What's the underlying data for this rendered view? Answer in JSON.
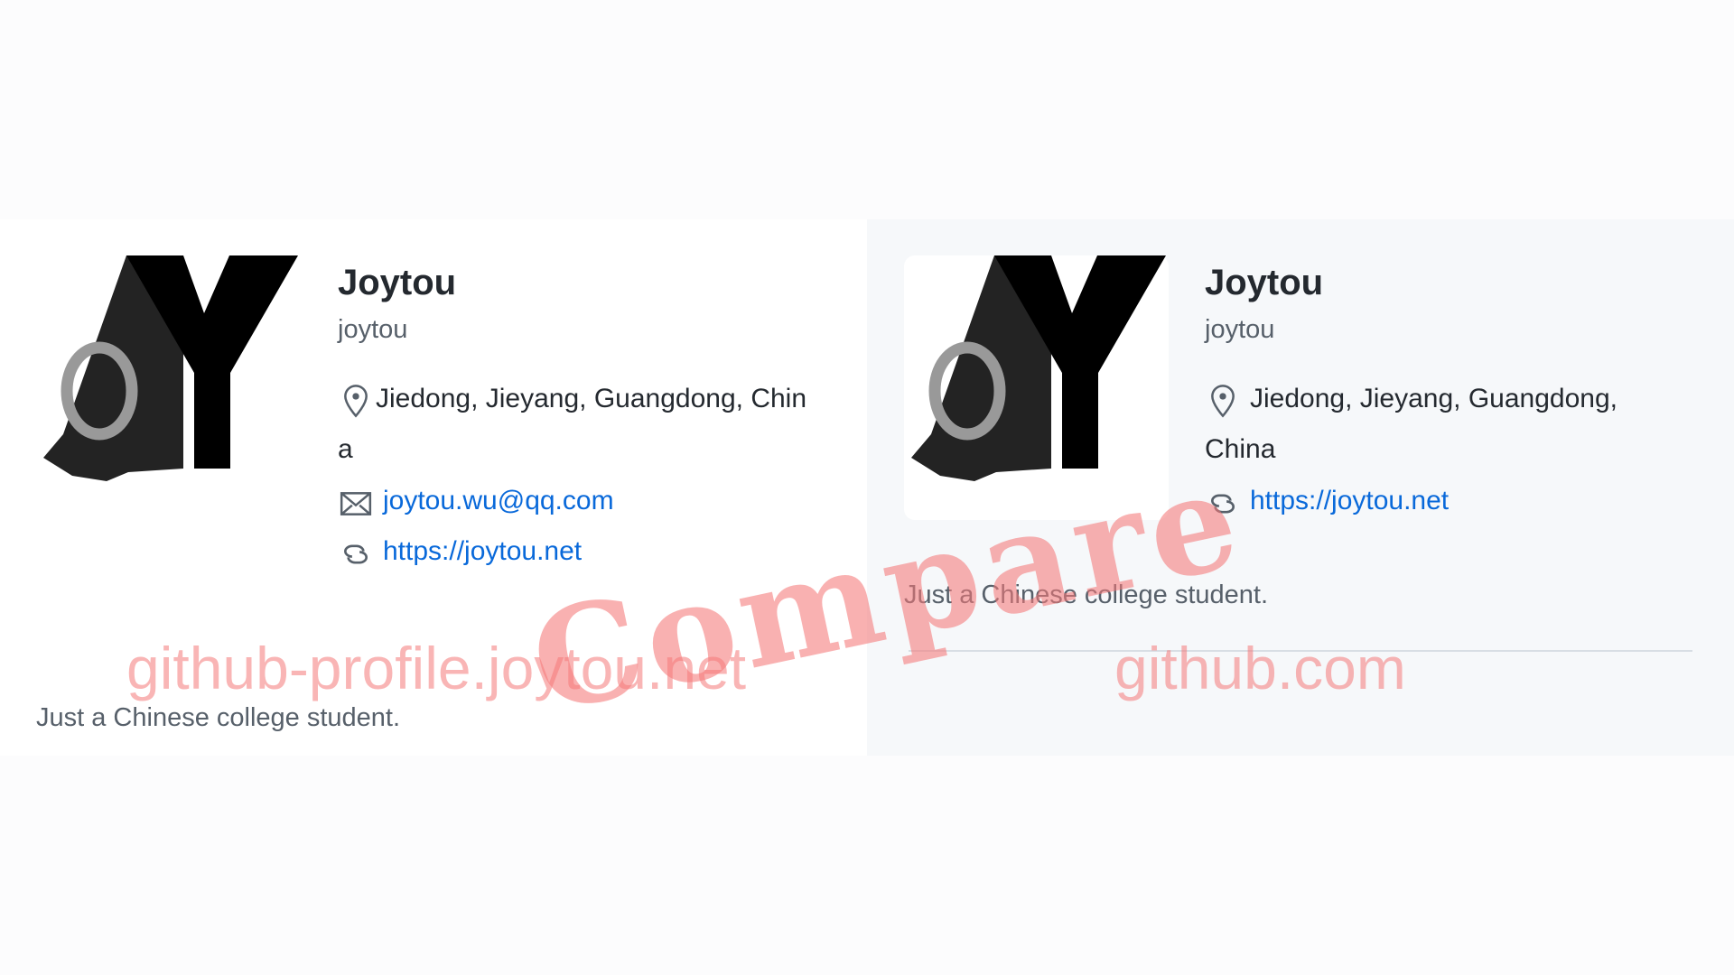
{
  "left_profile": {
    "name": "Joytou",
    "login": "joytou",
    "location_line1": "Jiedong, Jieyang, Guangdong, Chin",
    "location_line2": "a",
    "email": "joytou.wu@qq.com",
    "website": "https://joytou.net",
    "bio": "Just a Chinese college student."
  },
  "right_profile": {
    "name": "Joytou",
    "login": "joytou",
    "location_line1": "Jiedong, Jieyang, Guangdong,",
    "location_line2": "China",
    "website": "https://joytou.net",
    "bio": "Just a Chinese college student."
  },
  "watermarks": {
    "left_site": "github-profile.joytou.net",
    "compare": "Compare",
    "right_site": "github.com"
  },
  "colors": {
    "link": "#0969da",
    "watermark": "#f47878",
    "right_panel_bg": "#f6f8fa"
  },
  "icons": {
    "location": "location-pin-icon",
    "email": "mail-icon",
    "website": "link-icon",
    "avatar": "joytou-jy-logo"
  }
}
